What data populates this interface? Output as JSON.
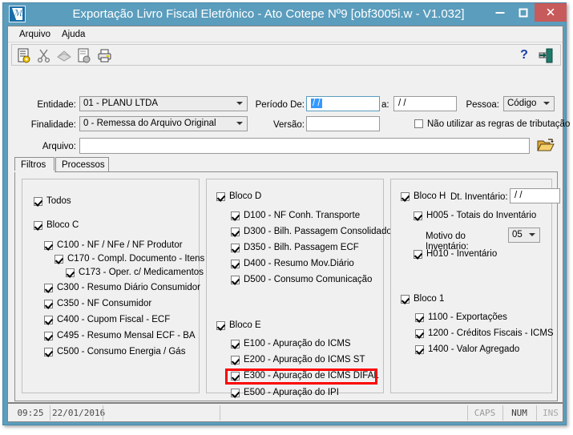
{
  "window": {
    "title": "Exportação Livro Fiscal Eletrônico - Ato Cotepe Nº9 [obf3005i.w - V1.032]",
    "minimize_label": "–",
    "maximize_label": "□",
    "close_label": "✕",
    "accent_color": "#5b9dbd",
    "close_color": "#c75b5b",
    "highlight_color": "#ff0000"
  },
  "menu": {
    "items": [
      {
        "label": "Arquivo"
      },
      {
        "label": "Ajuda"
      }
    ]
  },
  "toolbar": {
    "buttons": [
      {
        "name": "new-icon",
        "title": "Novo"
      },
      {
        "name": "cut-icon",
        "title": "Recortar"
      },
      {
        "name": "copy-icon",
        "title": "Copiar"
      },
      {
        "name": "paste-icon",
        "title": "Colar"
      },
      {
        "name": "print-icon",
        "title": "Imprimir"
      }
    ],
    "help_label": "?",
    "exit_name": "exit-icon"
  },
  "form": {
    "entidade_label": "Entidade:",
    "entidade_value": "01 - PLANU LTDA",
    "finalidade_label": "Finalidade:",
    "finalidade_value": "0 - Remessa do Arquivo Original",
    "arquivo_label": "Arquivo:",
    "arquivo_value": "",
    "periodo_label": "Período De:",
    "periodo_value": "/  /",
    "periodo_a_label": "a:",
    "periodo_a_value": "/  /",
    "versao_label": "Versão:",
    "versao_value": "",
    "pessoa_label": "Pessoa:",
    "pessoa_value": "Código",
    "nao_utilizar_label": "Não utilizar as regras de tributação",
    "nao_utilizar_checked": false,
    "open_file_icon": "open-folder-icon"
  },
  "tabs": [
    {
      "label": "Filtros",
      "active": true
    },
    {
      "label": "Processos",
      "active": false
    }
  ],
  "filters": {
    "col1": {
      "todos": {
        "label": "Todos",
        "checked": true
      },
      "bloco_c": {
        "label": "Bloco C",
        "checked": true
      },
      "items": [
        {
          "label": "C100 - NF / NFe / NF Produtor",
          "checked": true,
          "indent": 1
        },
        {
          "label": "C170 - Compl. Documento - Itens",
          "checked": true,
          "indent": 2
        },
        {
          "label": "C173 - Oper. c/ Medicamentos",
          "checked": true,
          "indent": 3
        },
        {
          "label": "C300 - Resumo Diário Consumidor",
          "checked": true,
          "indent": 1
        },
        {
          "label": "C350 - NF Consumidor",
          "checked": true,
          "indent": 1
        },
        {
          "label": "C400 - Cupom Fiscal - ECF",
          "checked": true,
          "indent": 1
        },
        {
          "label": "C495 - Resumo Mensal ECF - BA",
          "checked": true,
          "indent": 1
        },
        {
          "label": "C500 - Consumo Energia / Gás",
          "checked": true,
          "indent": 1
        }
      ]
    },
    "col2": {
      "bloco_d": {
        "label": "Bloco D",
        "checked": true
      },
      "d_items": [
        {
          "label": "D100 - NF Conh. Transporte",
          "checked": true
        },
        {
          "label": "D300 - Bilh. Passagem Consolidado",
          "checked": true
        },
        {
          "label": "D350 - Bilh. Passagem ECF",
          "checked": true
        },
        {
          "label": "D400 - Resumo Mov.Diário",
          "checked": true
        },
        {
          "label": "D500 - Consumo Comunicação",
          "checked": true
        }
      ],
      "bloco_e": {
        "label": "Bloco E",
        "checked": true
      },
      "e_items": [
        {
          "label": "E100 - Apuração do ICMS",
          "checked": true,
          "highlighted": false
        },
        {
          "label": "E200 - Apuração do ICMS ST",
          "checked": true,
          "highlighted": false
        },
        {
          "label": "E300 - Apuração de ICMS DIFAL",
          "checked": true,
          "highlighted": true
        },
        {
          "label": "E500 - Apuração do IPI",
          "checked": true,
          "highlighted": false
        }
      ]
    },
    "col3": {
      "bloco_h": {
        "label": "Bloco H",
        "checked": true
      },
      "dt_inventario_label": "Dt. Inventário:",
      "dt_inventario_value": "/  /",
      "h005": {
        "label": "H005 - Totais do Inventário",
        "checked": true
      },
      "motivo_label": "Motivo do Inventário:",
      "motivo_value": "05",
      "h010": {
        "label": "H010 - Inventário",
        "checked": true
      },
      "bloco_1": {
        "label": "Bloco 1",
        "checked": true
      },
      "items_1": [
        {
          "label": "1100 - Exportações",
          "checked": true
        },
        {
          "label": "1200 - Créditos Fiscais - ICMS",
          "checked": true
        },
        {
          "label": "1400 - Valor Agregado",
          "checked": true
        }
      ]
    }
  },
  "statusbar": {
    "time": "09:25",
    "date": "22/01/2016",
    "message": "",
    "caps": "CAPS",
    "num": "NUM",
    "ins": "INS"
  }
}
